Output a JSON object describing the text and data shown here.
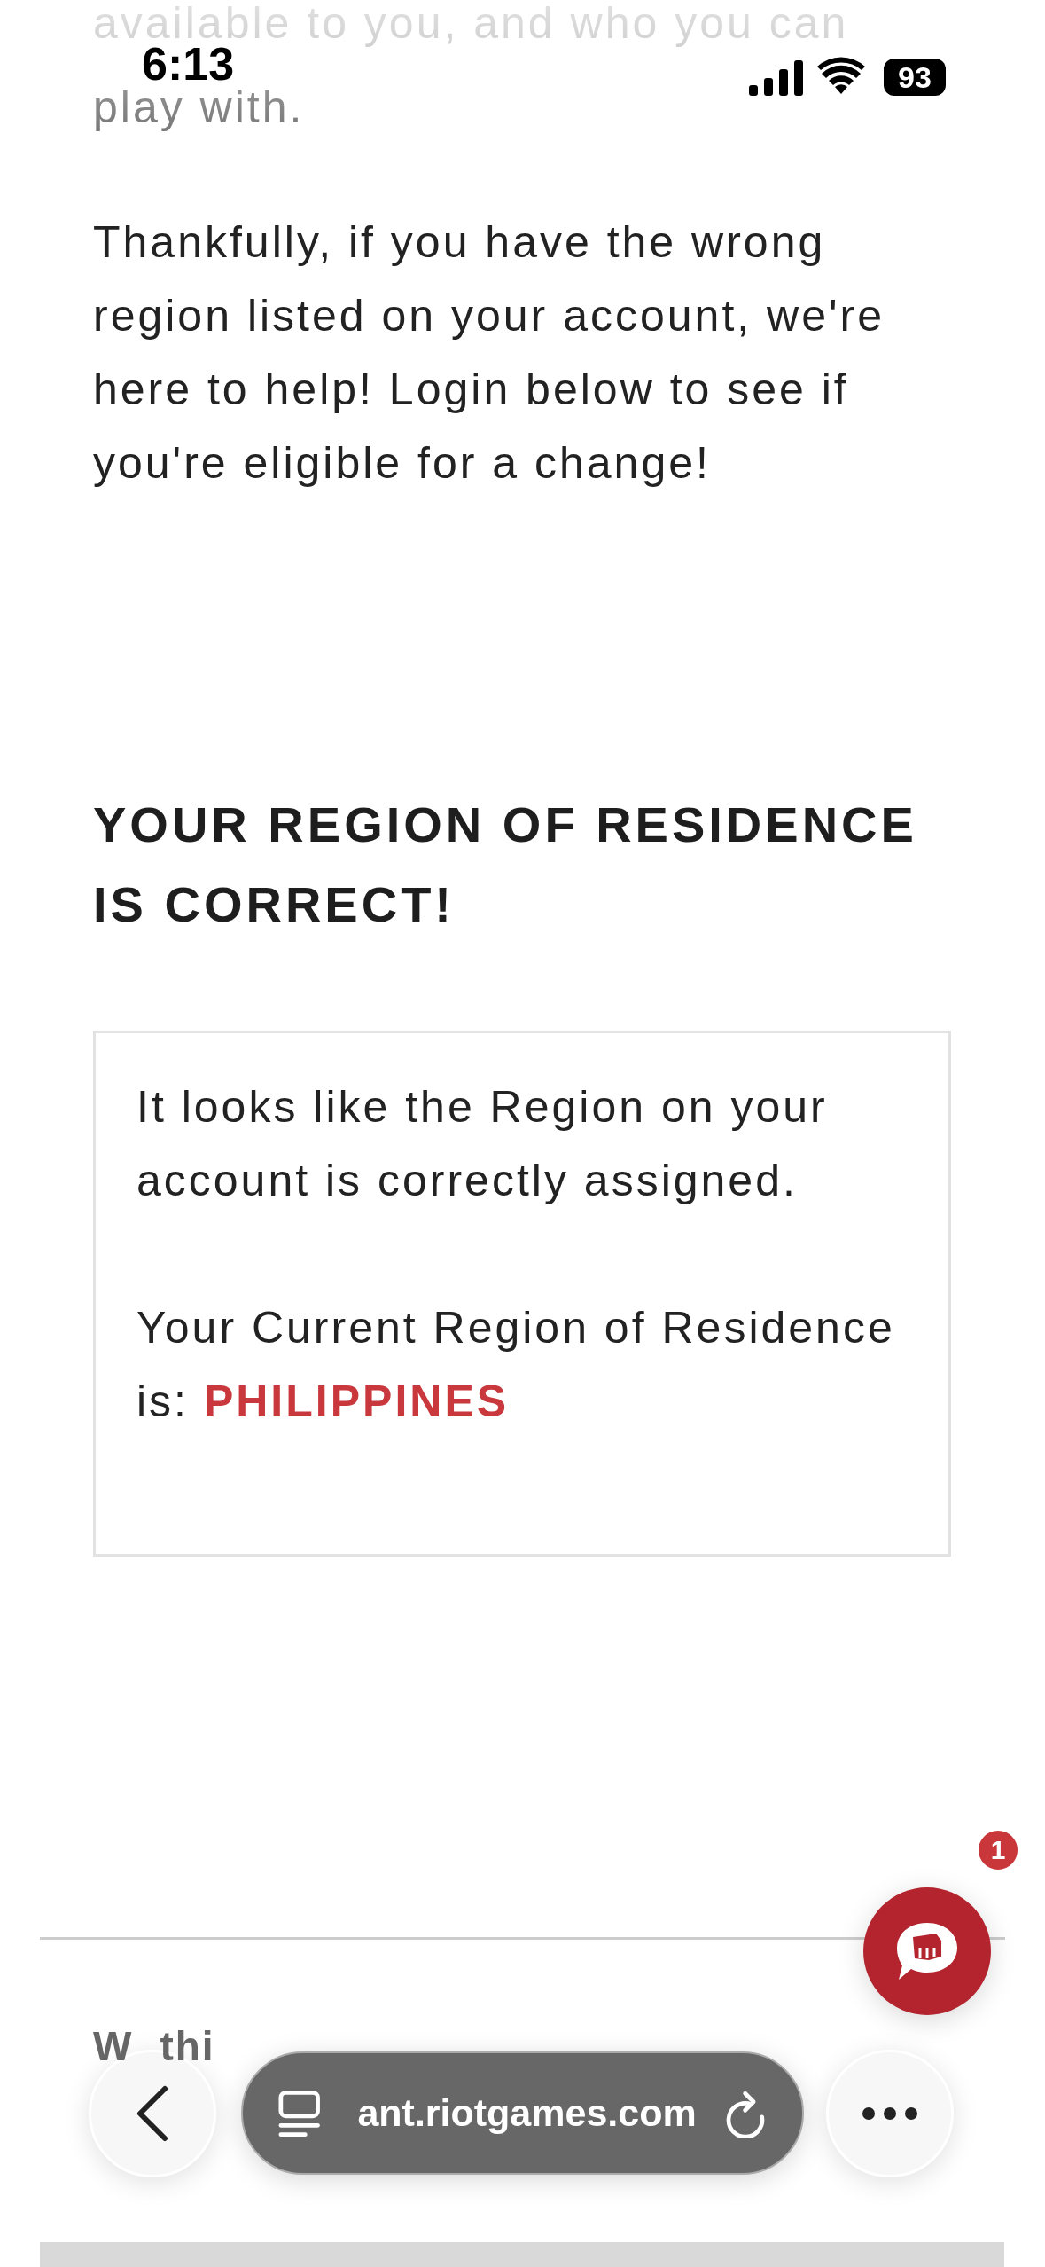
{
  "status_bar": {
    "time": "6:13",
    "battery": "93"
  },
  "top_lines": [
    "available to you, and who you can",
    "play with."
  ],
  "paragraphs": [
    "Thankfully, if you have the wrong region listed on your account, we're here to help! Login below to see if you're eligible for a change!"
  ],
  "result": {
    "heading": "YOUR REGION OF RESIDENCE IS CORRECT!",
    "lines": [
      "It looks like the Region on your account is correctly assigned.",
      "Your Current Region of Residence is: **PHILIPPINES**"
    ]
  },
  "chat": {
    "badge": "1"
  },
  "feedback": {
    "heading_fragments": [
      "W",
      "thi"
    ]
  },
  "browser_bar": {
    "url": "ant.riotgames.com"
  }
}
